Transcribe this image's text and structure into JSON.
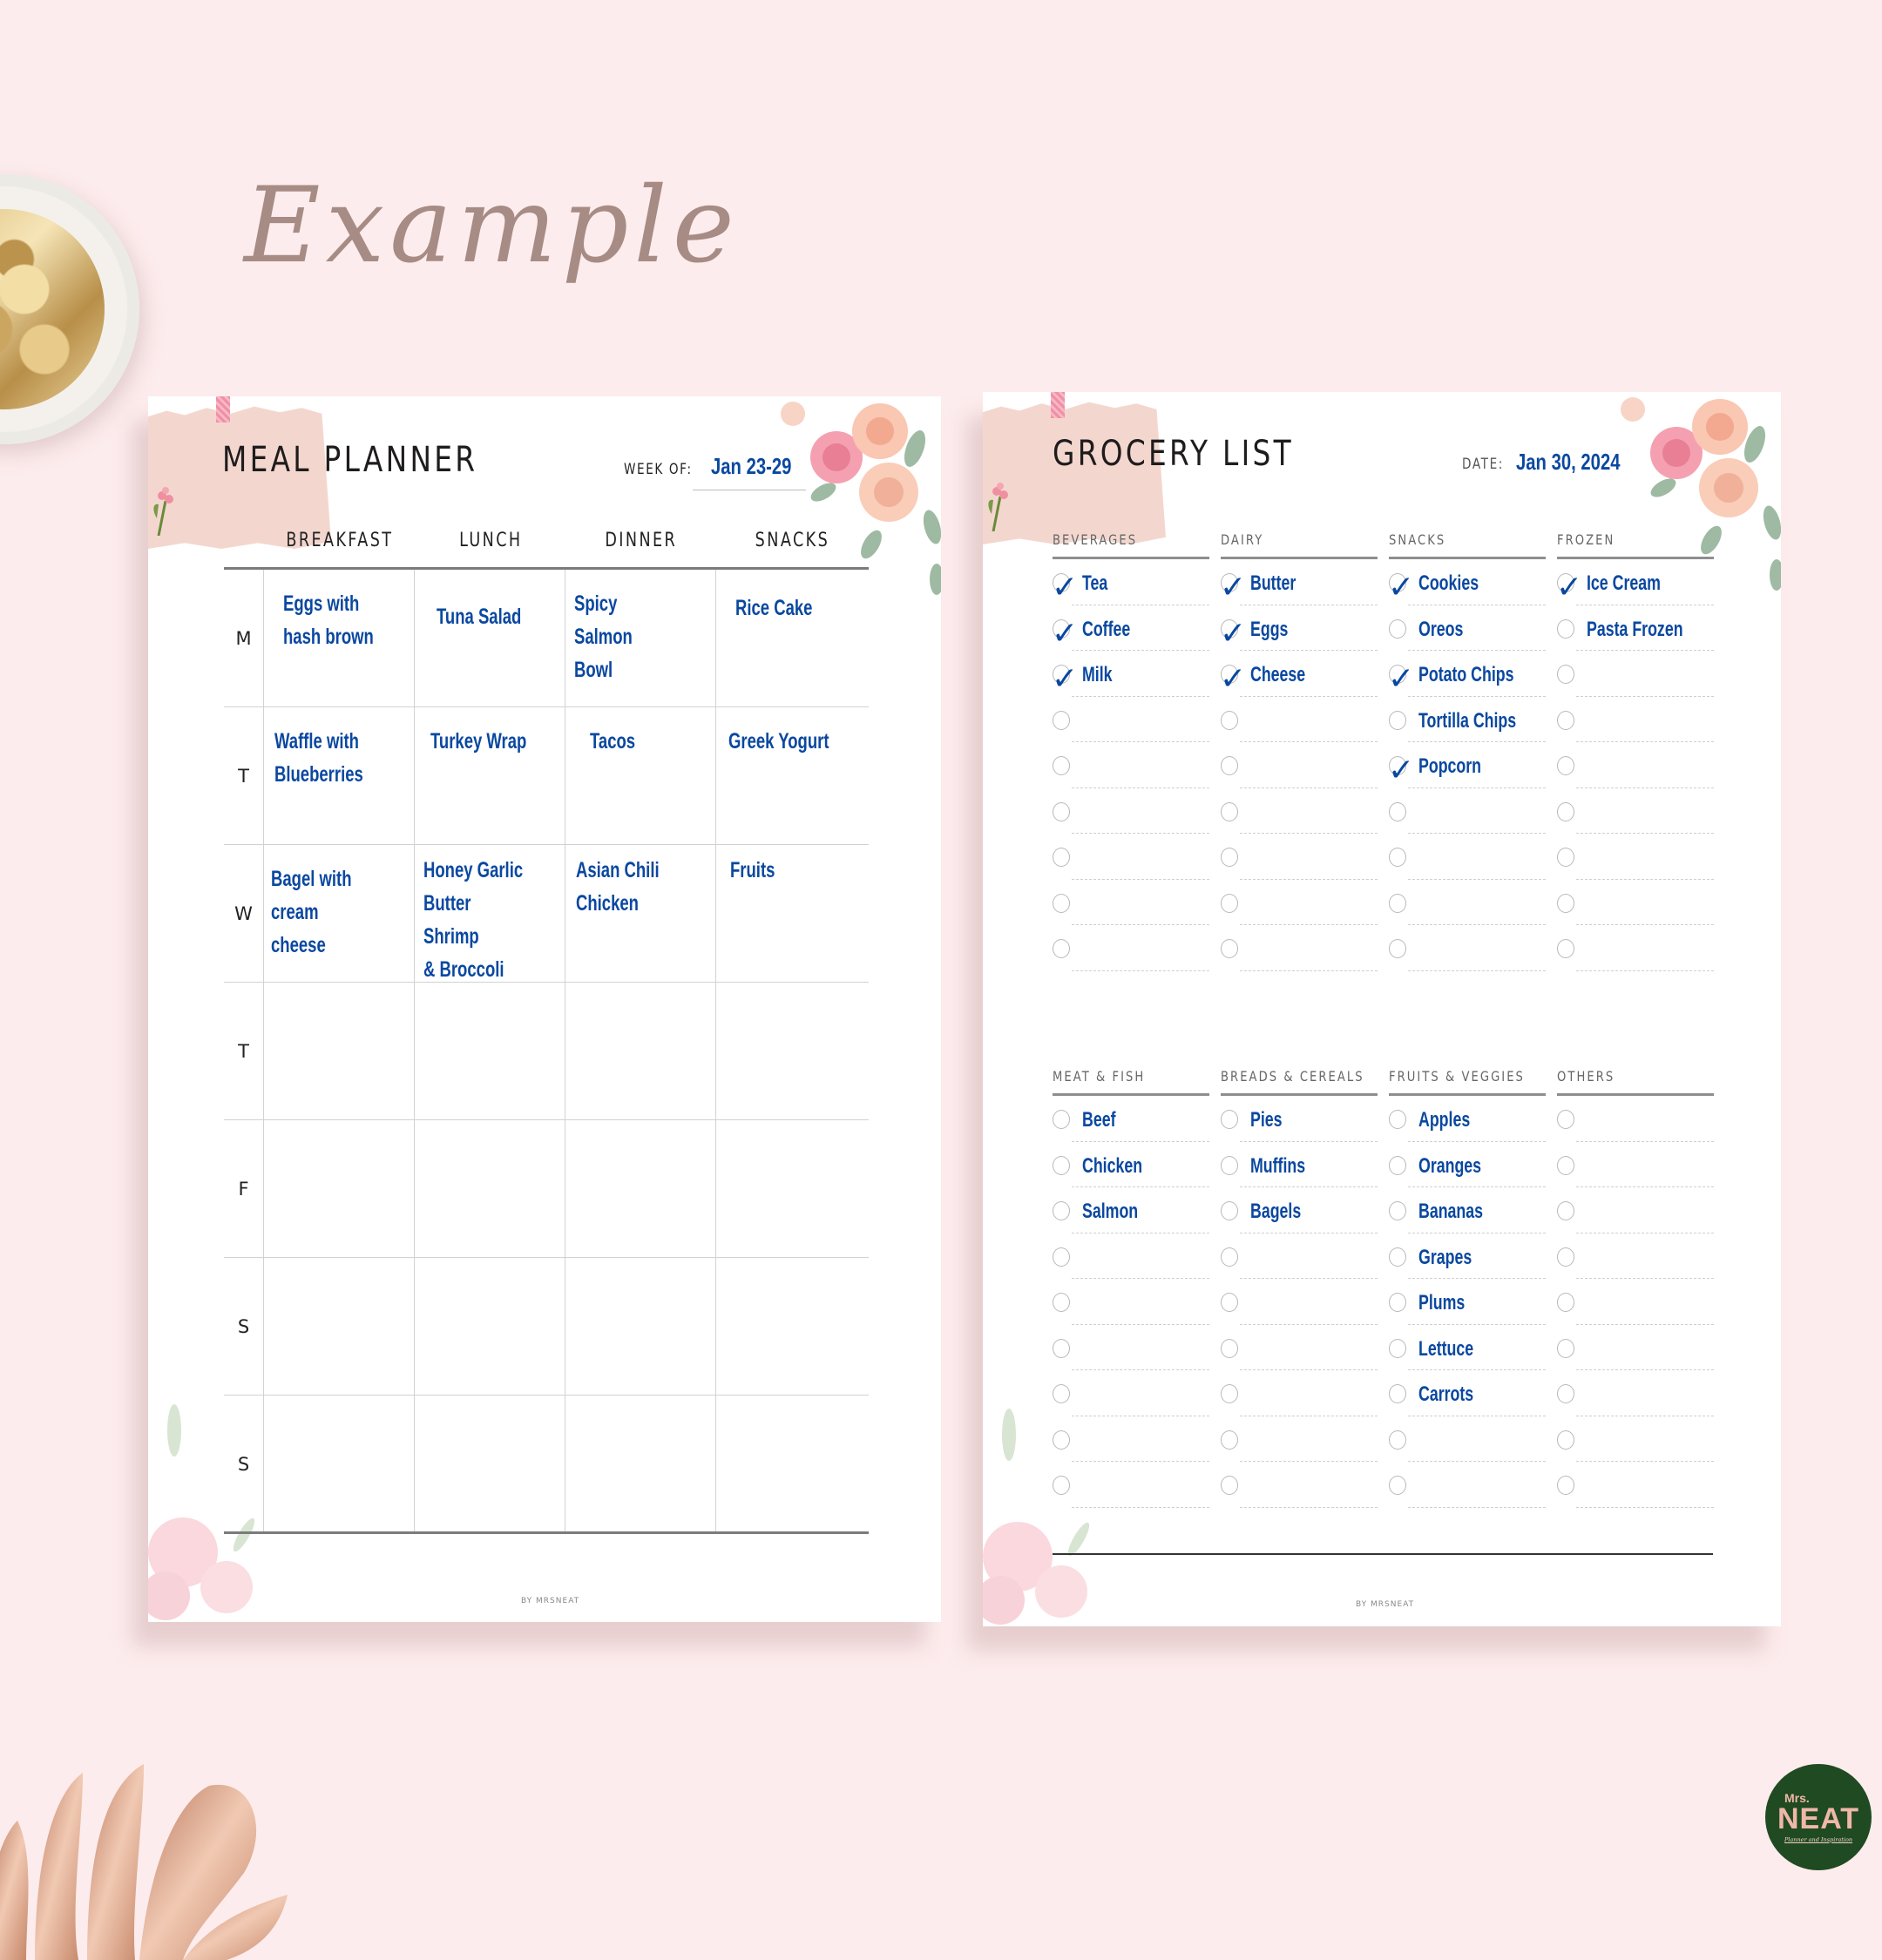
{
  "background": {
    "heading": "Example",
    "colors": {
      "background": "#fdeced",
      "heading": "#a68c84",
      "ink": "#0a48a0"
    }
  },
  "logo": {
    "line1": "Mrs.",
    "line2": "NEAT",
    "tagline": "Planner and Inspiration"
  },
  "meal_planner": {
    "title": "MEAL PLANNER",
    "week_label": "WEEK OF:",
    "week_value": "Jan 23-29",
    "columns": [
      "BREAKFAST",
      "LUNCH",
      "DINNER",
      "SNACKS"
    ],
    "rows": [
      {
        "day": "M",
        "cells": [
          "Eggs with\nhash brown",
          "Tuna Salad",
          "Spicy Salmon\nBowl",
          "Rice Cake"
        ]
      },
      {
        "day": "T",
        "cells": [
          "Waffle with\nBlueberries",
          "Turkey Wrap",
          "Tacos",
          "Greek Yogurt"
        ]
      },
      {
        "day": "W",
        "cells": [
          "Bagel with\ncream cheese",
          "Honey Garlic\nButter Shrimp\n& Broccoli",
          "Asian Chili\nChicken",
          "Fruits"
        ]
      },
      {
        "day": "T",
        "cells": [
          "",
          "",
          "",
          ""
        ]
      },
      {
        "day": "F",
        "cells": [
          "",
          "",
          "",
          ""
        ]
      },
      {
        "day": "S",
        "cells": [
          "",
          "",
          "",
          ""
        ]
      },
      {
        "day": "S",
        "cells": [
          "",
          "",
          "",
          ""
        ]
      }
    ],
    "footer": "BY MRSNEAT"
  },
  "grocery_list": {
    "title": "GROCERY LIST",
    "date_label": "DATE:",
    "date_value": "Jan 30, 2024",
    "sections_top": [
      {
        "name": "BEVERAGES",
        "items": [
          {
            "label": "Tea",
            "checked": true
          },
          {
            "label": "Coffee",
            "checked": true
          },
          {
            "label": "Milk",
            "checked": true
          },
          {
            "label": "",
            "checked": false
          },
          {
            "label": "",
            "checked": false
          },
          {
            "label": "",
            "checked": false
          },
          {
            "label": "",
            "checked": false
          },
          {
            "label": "",
            "checked": false
          },
          {
            "label": "",
            "checked": false
          }
        ]
      },
      {
        "name": "DAIRY",
        "items": [
          {
            "label": "Butter",
            "checked": true
          },
          {
            "label": "Eggs",
            "checked": true
          },
          {
            "label": "Cheese",
            "checked": true
          },
          {
            "label": "",
            "checked": false
          },
          {
            "label": "",
            "checked": false
          },
          {
            "label": "",
            "checked": false
          },
          {
            "label": "",
            "checked": false
          },
          {
            "label": "",
            "checked": false
          },
          {
            "label": "",
            "checked": false
          }
        ]
      },
      {
        "name": "SNACKS",
        "items": [
          {
            "label": "Cookies",
            "checked": true
          },
          {
            "label": "Oreos",
            "checked": false
          },
          {
            "label": "Potato Chips",
            "checked": true
          },
          {
            "label": "Tortilla Chips",
            "checked": false
          },
          {
            "label": "Popcorn",
            "checked": true
          },
          {
            "label": "",
            "checked": false
          },
          {
            "label": "",
            "checked": false
          },
          {
            "label": "",
            "checked": false
          },
          {
            "label": "",
            "checked": false
          }
        ]
      },
      {
        "name": "FROZEN",
        "items": [
          {
            "label": "Ice Cream",
            "checked": true
          },
          {
            "label": "Pasta Frozen",
            "checked": false
          },
          {
            "label": "",
            "checked": false
          },
          {
            "label": "",
            "checked": false
          },
          {
            "label": "",
            "checked": false
          },
          {
            "label": "",
            "checked": false
          },
          {
            "label": "",
            "checked": false
          },
          {
            "label": "",
            "checked": false
          },
          {
            "label": "",
            "checked": false
          }
        ]
      }
    ],
    "sections_bottom": [
      {
        "name": "MEAT & FISH",
        "items": [
          {
            "label": "Beef",
            "checked": false
          },
          {
            "label": "Chicken",
            "checked": false
          },
          {
            "label": "Salmon",
            "checked": false
          },
          {
            "label": "",
            "checked": false
          },
          {
            "label": "",
            "checked": false
          },
          {
            "label": "",
            "checked": false
          },
          {
            "label": "",
            "checked": false
          },
          {
            "label": "",
            "checked": false
          },
          {
            "label": "",
            "checked": false
          }
        ]
      },
      {
        "name": "BREADS & CEREALS",
        "items": [
          {
            "label": "Pies",
            "checked": false
          },
          {
            "label": "Muffins",
            "checked": false
          },
          {
            "label": "Bagels",
            "checked": false
          },
          {
            "label": "",
            "checked": false
          },
          {
            "label": "",
            "checked": false
          },
          {
            "label": "",
            "checked": false
          },
          {
            "label": "",
            "checked": false
          },
          {
            "label": "",
            "checked": false
          },
          {
            "label": "",
            "checked": false
          }
        ]
      },
      {
        "name": "FRUITS & VEGGIES",
        "items": [
          {
            "label": "Apples",
            "checked": false
          },
          {
            "label": "Oranges",
            "checked": false
          },
          {
            "label": "Bananas",
            "checked": false
          },
          {
            "label": "Grapes",
            "checked": false
          },
          {
            "label": "Plums",
            "checked": false
          },
          {
            "label": "Lettuce",
            "checked": false
          },
          {
            "label": "Carrots",
            "checked": false
          },
          {
            "label": "",
            "checked": false
          },
          {
            "label": "",
            "checked": false
          }
        ]
      },
      {
        "name": "OTHERS",
        "items": [
          {
            "label": "",
            "checked": false
          },
          {
            "label": "",
            "checked": false
          },
          {
            "label": "",
            "checked": false
          },
          {
            "label": "",
            "checked": false
          },
          {
            "label": "",
            "checked": false
          },
          {
            "label": "",
            "checked": false
          },
          {
            "label": "",
            "checked": false
          },
          {
            "label": "",
            "checked": false
          },
          {
            "label": "",
            "checked": false
          }
        ]
      }
    ],
    "footer": "BY MRSNEAT"
  }
}
